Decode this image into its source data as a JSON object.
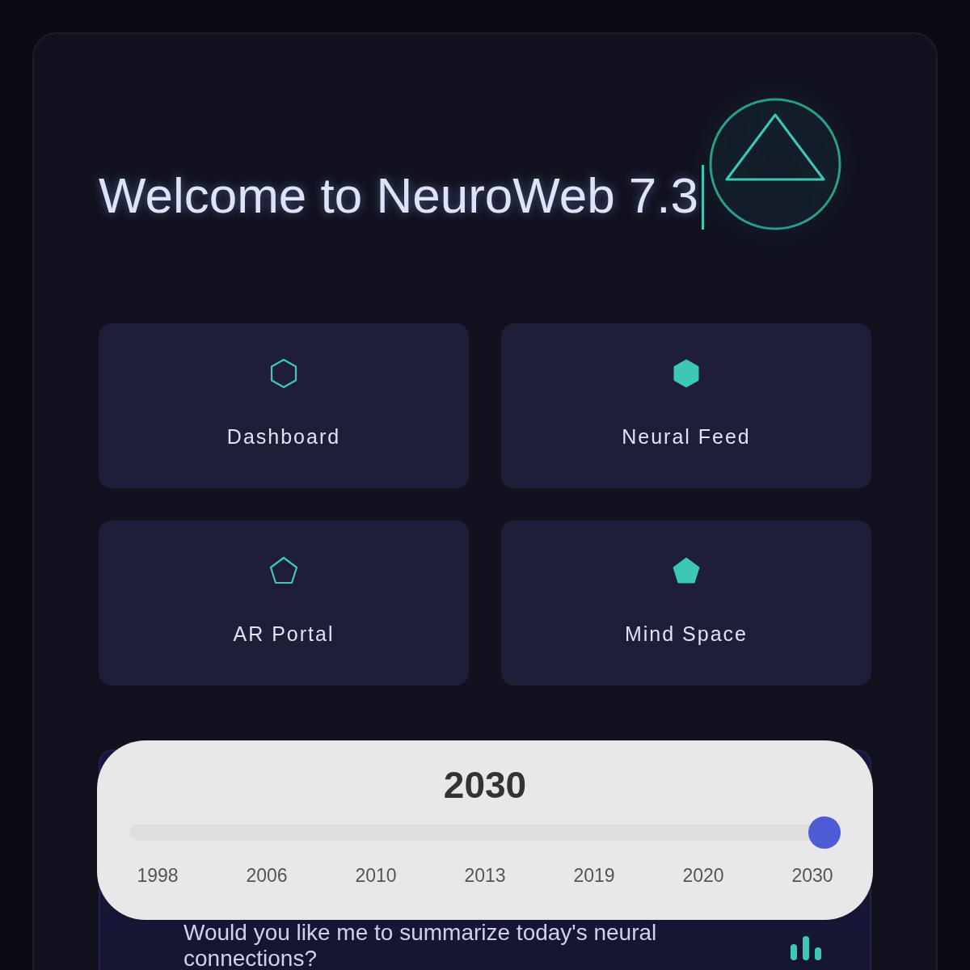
{
  "title": "Welcome to NeuroWeb 7.3",
  "tiles": [
    {
      "label": "Dashboard",
      "kind": "hexagon",
      "filled": false
    },
    {
      "label": "Neural Feed",
      "kind": "hexagon",
      "filled": true
    },
    {
      "label": "AR Portal",
      "kind": "pentagon",
      "filled": false
    },
    {
      "label": "Mind Space",
      "kind": "pentagon",
      "filled": true
    }
  ],
  "assistant": {
    "message": "Would you like me to summarize today's neural connections?"
  },
  "year_slider": {
    "value": "2030",
    "level": 1,
    "ticks": [
      "1998",
      "2006",
      "2010",
      "2013",
      "2019",
      "2020",
      "2030"
    ]
  }
}
